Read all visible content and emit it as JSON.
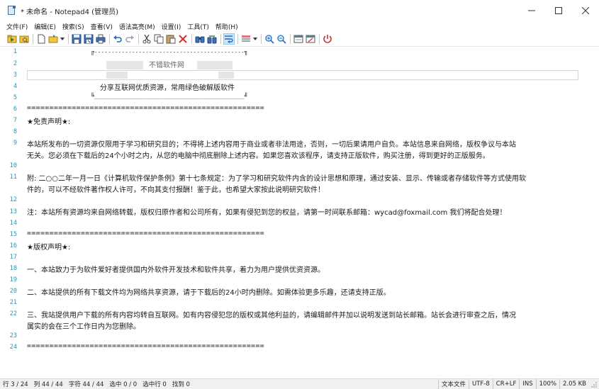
{
  "window": {
    "title": "* 未命名 - Notepad4 (管理员)"
  },
  "menu": [
    {
      "label": "文件(F)"
    },
    {
      "label": "编辑(E)"
    },
    {
      "label": "搜索(S)"
    },
    {
      "label": "查看(V)"
    },
    {
      "label": "语法高亮(M)"
    },
    {
      "label": "设置(I)"
    },
    {
      "label": "工具(T)"
    },
    {
      "label": "帮助(H)"
    }
  ],
  "toolbar": {
    "icons": [
      "run-icon",
      "open-folder-icon",
      "new-file-icon",
      "browse-icon",
      "save-icon",
      "save-as-icon",
      "print-icon",
      "undo-icon",
      "redo-icon",
      "cut-icon",
      "copy-icon",
      "paste-icon",
      "delete-icon",
      "find-icon",
      "replace-icon",
      "word-wrap-icon",
      "scheme-icon",
      "zoom-in-icon",
      "zoom-out-icon",
      "settings-icon",
      "edit-scheme-icon",
      "exit-icon"
    ]
  },
  "editor": {
    "line_numbers": [
      "1",
      "2",
      "3",
      "4",
      "5",
      "6",
      "7",
      "8",
      "9",
      "10",
      "11",
      "12",
      "13",
      "14",
      "15",
      "16",
      "17",
      "18",
      "19",
      "20",
      "21",
      "22",
      "23",
      "24"
    ],
    "box_top": "╔--------------------------------------------╗",
    "box_bottom": "╚____________________________________________╝",
    "title_partial": "不错软件网",
    "slogan": "分享互联网优质资源，常用绿色破解版软件",
    "separator": "=====================================================",
    "disclaimer_heading": "★免责声明★:",
    "p9a": "本站所发布的一切资源仅限用于学习和研究目的；不得将上述内容用于商业或者非法用途，否则，一切后果请用户自负。本站信息来自网络，版权争议与本站",
    "p9b": "无关。您必须在下载后的24个小时之内，从您的电脑中彻底删除上述内容。如果您喜欢该程序，请支持正版软件，购买注册，得到更好的正版服务。",
    "p11a": "附: 二○○二年一月一日《计算机软件保护条例》第十七条规定：为了学习和研究软件内含的设计思想和原理，通过安装、显示、传输或者存储软件等方式使用软",
    "p11b": "件的，可以不经软件著作权人许可，不向其支付报酬！鉴于此，也希望大家按此说明研究软件！",
    "p13": "注：本站所有资源均来自网络转载，版权归原作者和公司所有，如果有侵犯到您的权益，请第一时间联系邮箱：wycad@foxmail.com 我们将配合处理！",
    "copyright_heading": "★版权声明★:",
    "p18": "一、本站致力于为软件爱好者提供国内外软件开发技术和软件共享，着力为用户提供优资资源。",
    "p20": "二、本站提供的所有下载文件均为网络共享资源，请于下载后的24小时内删除。如需体验更多乐趣，还请支持正版。",
    "p22a": "三、我站提供用户下载的所有内容均转自互联网。如有内容侵犯您的版权或其他利益的，请编辑邮件并加以说明发送到站长邮箱。站长会进行审查之后，情况",
    "p22b": "属实的会在三个工作日内为您删除。"
  },
  "statusbar": {
    "line": "行 3 / 24",
    "col": "列 44 / 44",
    "chars": "字符 44 / 44",
    "selection": "选中 0 / 0",
    "selected_lines": "选中行 0",
    "found": "找到 0",
    "file_type": "文本文件",
    "encoding": "UTF-8",
    "eol": "CR+LF",
    "ins": "INS",
    "zoom": "100%",
    "size": "2.05 KB"
  },
  "colors": {
    "line_number": "#2b91af",
    "statusbar_bg": "#f0f0f0",
    "accent": "#3a6ea5"
  }
}
